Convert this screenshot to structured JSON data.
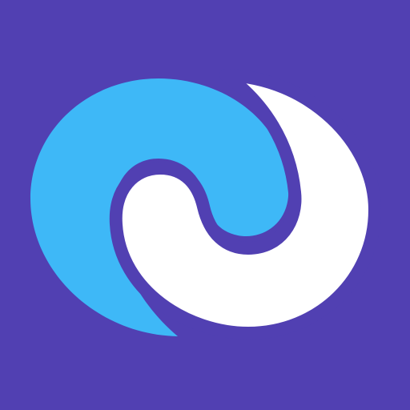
{
  "icon": {
    "name": "swirl-logo-icon",
    "background_color": "#5140b2",
    "primary_color": "#3eb8f7",
    "secondary_color": "#ffffff",
    "outline_color": "#5140b2"
  }
}
